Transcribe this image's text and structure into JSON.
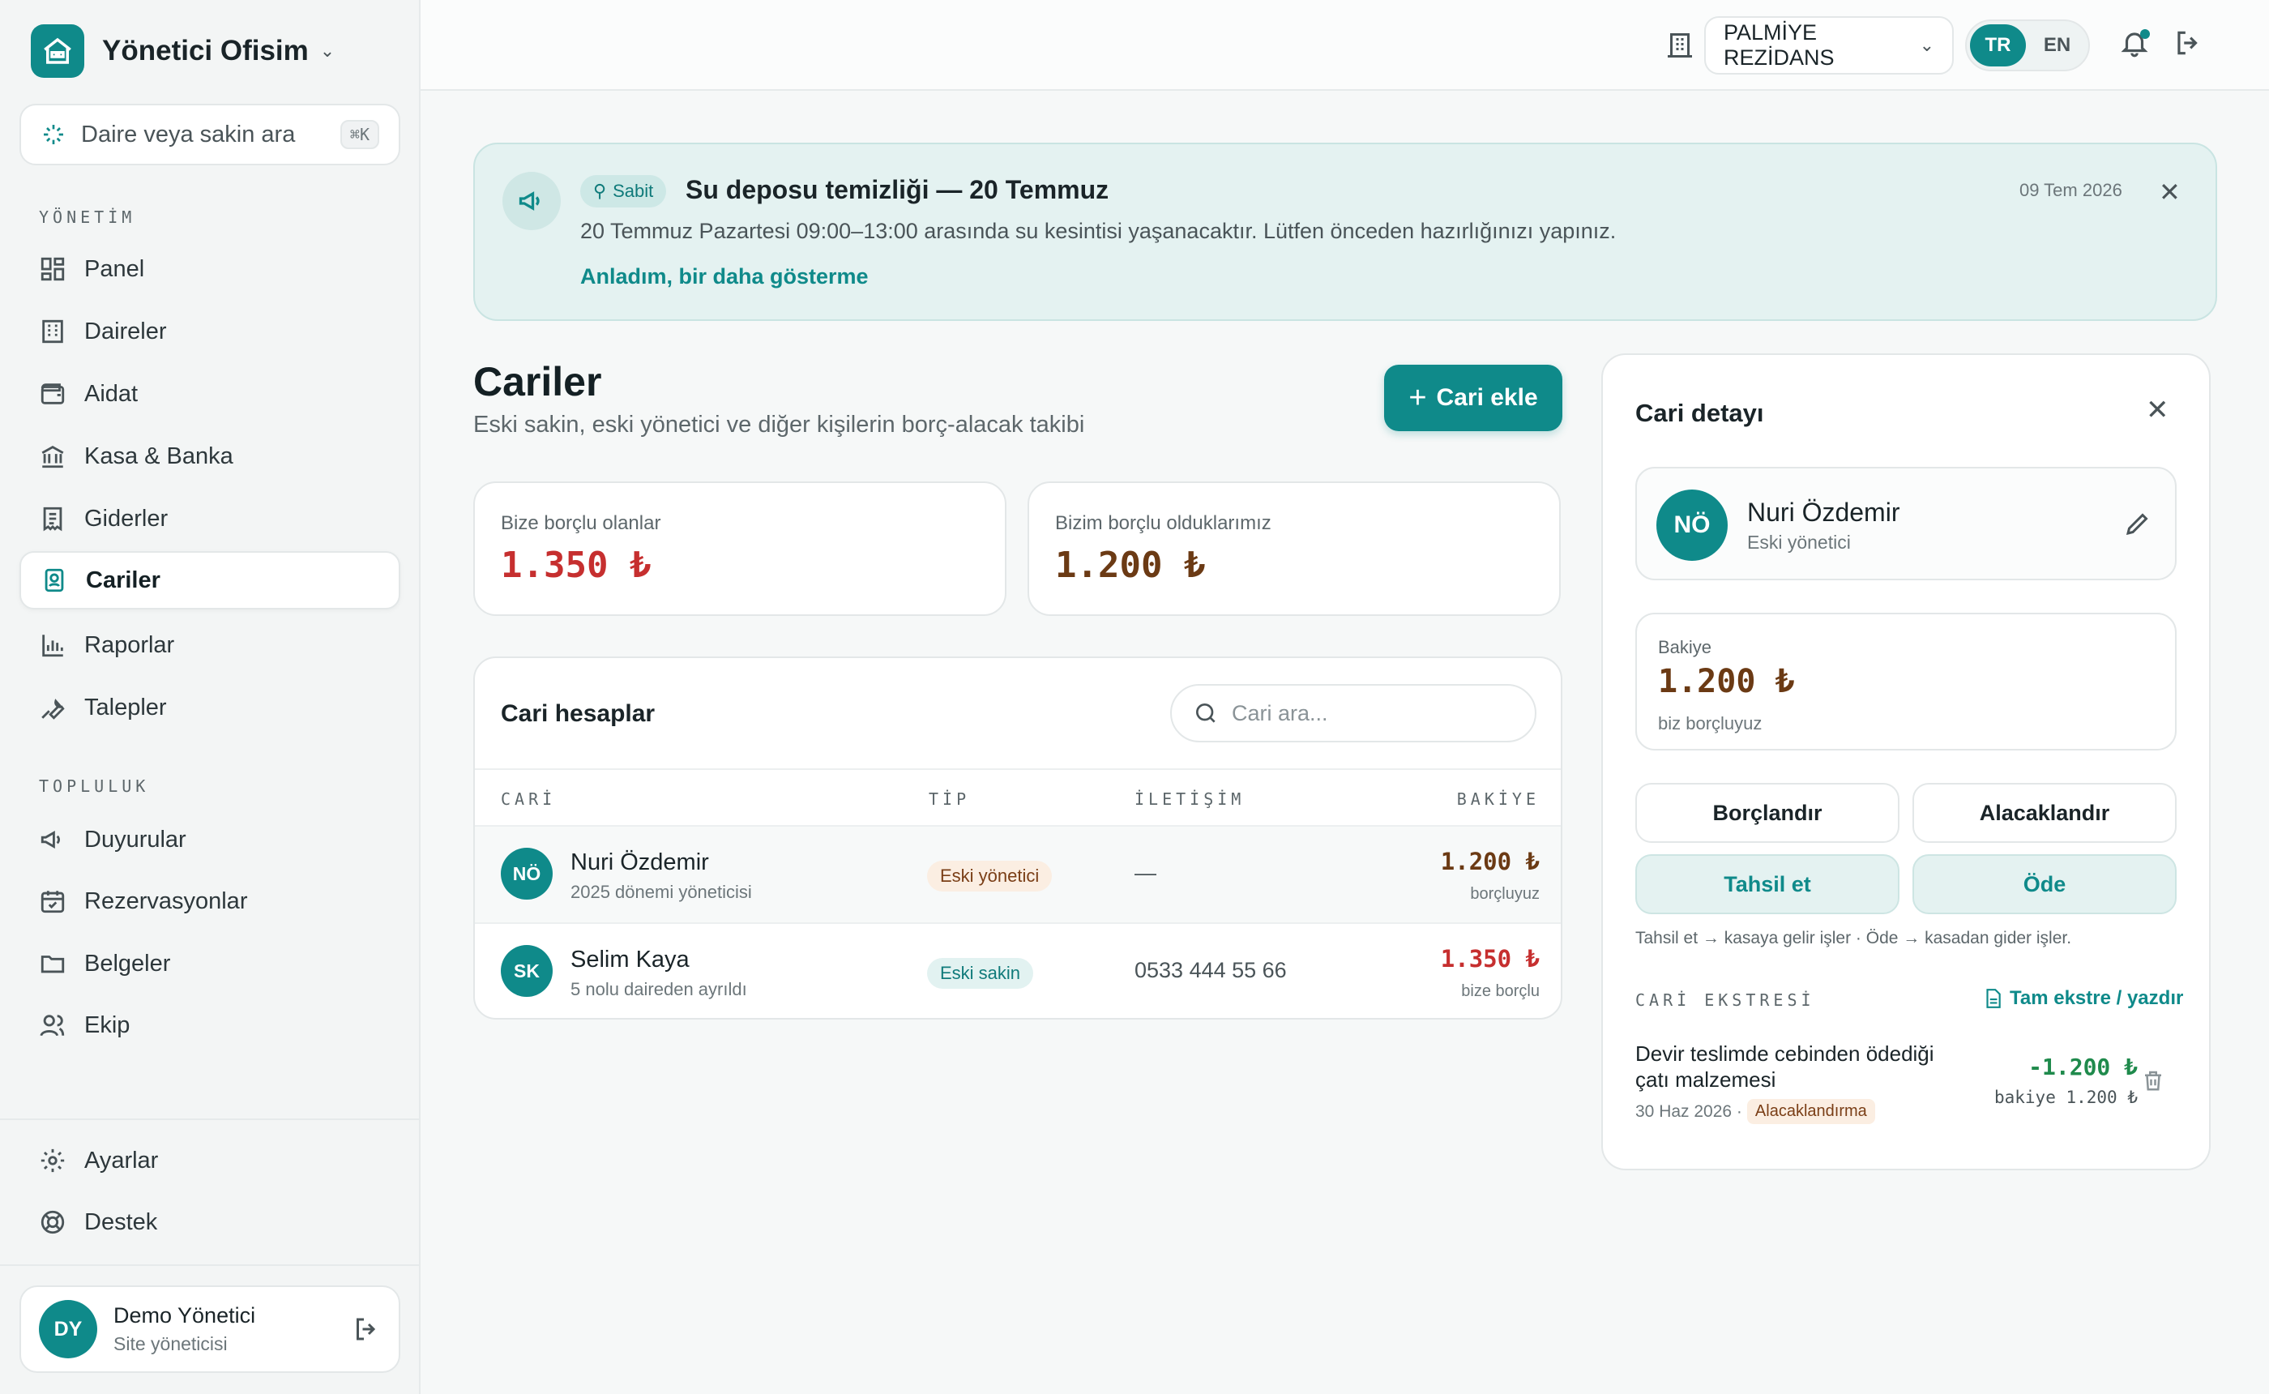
{
  "brand": {
    "name": "Yönetici Ofisim"
  },
  "sidebar": {
    "search_placeholder": "Daire veya sakin ara",
    "search_shortcut": "⌘K",
    "section_management": "YÖNETİM",
    "section_community": "TOPLULUK",
    "items": [
      {
        "label": "Panel",
        "icon": "grid-icon"
      },
      {
        "label": "Daireler",
        "icon": "building-icon"
      },
      {
        "label": "Aidat",
        "icon": "wallet-icon"
      },
      {
        "label": "Kasa & Banka",
        "icon": "bank-icon"
      },
      {
        "label": "Giderler",
        "icon": "receipt-icon"
      },
      {
        "label": "Cariler",
        "icon": "contact-book-icon",
        "active": true
      },
      {
        "label": "Raporlar",
        "icon": "bar-chart-icon"
      },
      {
        "label": "Talepler",
        "icon": "wrench-icon"
      }
    ],
    "community_items": [
      {
        "label": "Duyurular",
        "icon": "megaphone-icon"
      },
      {
        "label": "Rezervasyonlar",
        "icon": "calendar-icon"
      },
      {
        "label": "Belgeler",
        "icon": "folder-icon"
      },
      {
        "label": "Ekip",
        "icon": "users-icon"
      }
    ],
    "bottom_items": [
      {
        "label": "Ayarlar",
        "icon": "gear-icon"
      },
      {
        "label": "Destek",
        "icon": "lifebuoy-icon"
      }
    ],
    "user": {
      "initials": "DY",
      "name": "Demo Yönetici",
      "role": "Site yöneticisi"
    }
  },
  "topbar": {
    "site_name": "PALMİYE REZİDANS",
    "lang_tr": "TR",
    "lang_en": "EN"
  },
  "announcement": {
    "badge": "Sabit",
    "title": "Su deposu temizliği — 20 Temmuz",
    "date": "09 Tem 2026",
    "body": "20 Temmuz Pazartesi 09:00–13:00 arasında su kesintisi yaşanacaktır. Lütfen önceden hazırlığınızı yapınız.",
    "dismiss_link": "Anladım, bir daha gösterme"
  },
  "page": {
    "title": "Cariler",
    "subtitle": "Eski sakin, eski yönetici ve diğer kişilerin borç-alacak takibi",
    "add_button": "Cari ekle"
  },
  "stats": {
    "owed_to_us_label": "Bize borçlu olanlar",
    "owed_to_us_value": "1.350 ₺",
    "we_owe_label": "Bizim borçlu olduklarımız",
    "we_owe_value": "1.200 ₺"
  },
  "accounts": {
    "title": "Cari hesaplar",
    "search_placeholder": "Cari ara...",
    "columns": [
      "CARİ",
      "TİP",
      "İLETİŞİM",
      "BAKİYE"
    ],
    "rows": [
      {
        "initials": "NÖ",
        "name": "Nuri Özdemir",
        "note": "2025 dönemi yöneticisi",
        "type": "Eski yönetici",
        "contact": "—",
        "balance": "1.200 ₺",
        "balance_note": "borçluyuz"
      },
      {
        "initials": "SK",
        "name": "Selim Kaya",
        "note": "5 nolu daireden ayrıldı",
        "type": "Eski sakin",
        "contact": "0533 444 55 66",
        "balance": "1.350 ₺",
        "balance_note": "bize borçlu"
      }
    ]
  },
  "detail": {
    "title": "Cari detayı",
    "initials": "NÖ",
    "name": "Nuri Özdemir",
    "role": "Eski yönetici",
    "balance_label": "Bakiye",
    "balance_value": "1.200 ₺",
    "balance_note": "biz borçluyuz",
    "btn_debit": "Borçlandır",
    "btn_credit": "Alacaklandır",
    "btn_collect": "Tahsil et",
    "btn_pay": "Öde",
    "hint": "Tahsil et → kasaya gelir işler · Öde → kasadan gider işler.",
    "statement_label": "CARİ EKSTRESİ",
    "statement_link": "Tam ekstre / yazdır",
    "entry": {
      "description": "Devir teslimde cebinden ödediği çatı malzemesi",
      "date": "30 Haz 2026 ·",
      "badge": "Alacaklandırma",
      "amount": "-1.200 ₺",
      "running_balance": "bakiye 1.200 ₺"
    }
  },
  "colors": {
    "accent": "#0f8a8a",
    "negative": "#c62f2f",
    "debt": "#6b3a14",
    "positive": "#1f8a4c"
  }
}
